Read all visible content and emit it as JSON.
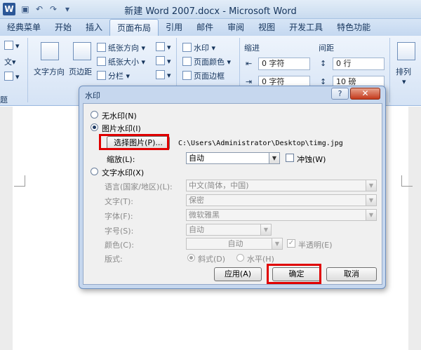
{
  "window": {
    "title": "新建 Word 2007.docx - Microsoft Word",
    "app_icon": "W"
  },
  "tabs": [
    "经典菜单",
    "开始",
    "插入",
    "页面布局",
    "引用",
    "邮件",
    "审阅",
    "视图",
    "开发工具",
    "特色功能"
  ],
  "ribbon": {
    "text_direction": "文字方向",
    "margins": "页边距",
    "paper_direction": "纸张方向",
    "paper_size": "纸张大小",
    "columns": "分栏",
    "watermark": "水印",
    "page_color": "页面颜色",
    "page_border": "页面边框",
    "indent_label": "缩进",
    "spacing_label": "间距",
    "indent_left_value": "0 字符",
    "indent_right_value": "0 字符",
    "spacing_before_value": "0 行",
    "spacing_after_value": "10 磅",
    "arrange": "排列",
    "theme_group_label": "题",
    "doc_char": "文"
  },
  "dialog": {
    "title": "水印",
    "help": "?",
    "close": "✕",
    "no_watermark": "无水印(N)",
    "picture_watermark": "图片水印(I)",
    "select_picture": "选择图片(P)...",
    "picture_path": "C:\\Users\\Administrator\\Desktop\\timg.jpg",
    "scale_label": "缩放(L):",
    "scale_value": "自动",
    "washout": "冲蚀(W)",
    "text_watermark": "文字水印(X)",
    "language_label": "语言(国家/地区)(L):",
    "language_value": "中文(简体，中国)",
    "text_label": "文字(T):",
    "text_value": "保密",
    "font_label": "字体(F):",
    "font_value": "微软雅黑",
    "size_label": "字号(S):",
    "size_value": "自动",
    "color_label": "颜色(C):",
    "color_value": "自动",
    "semitransparent": "半透明(E)",
    "layout_label": "版式:",
    "diagonal": "斜式(D)",
    "horizontal": "水平(H)",
    "apply": "应用(A)",
    "ok": "确定",
    "cancel": "取消"
  },
  "colors": {
    "highlight": "#e00000",
    "close_button": "#c4391c"
  }
}
